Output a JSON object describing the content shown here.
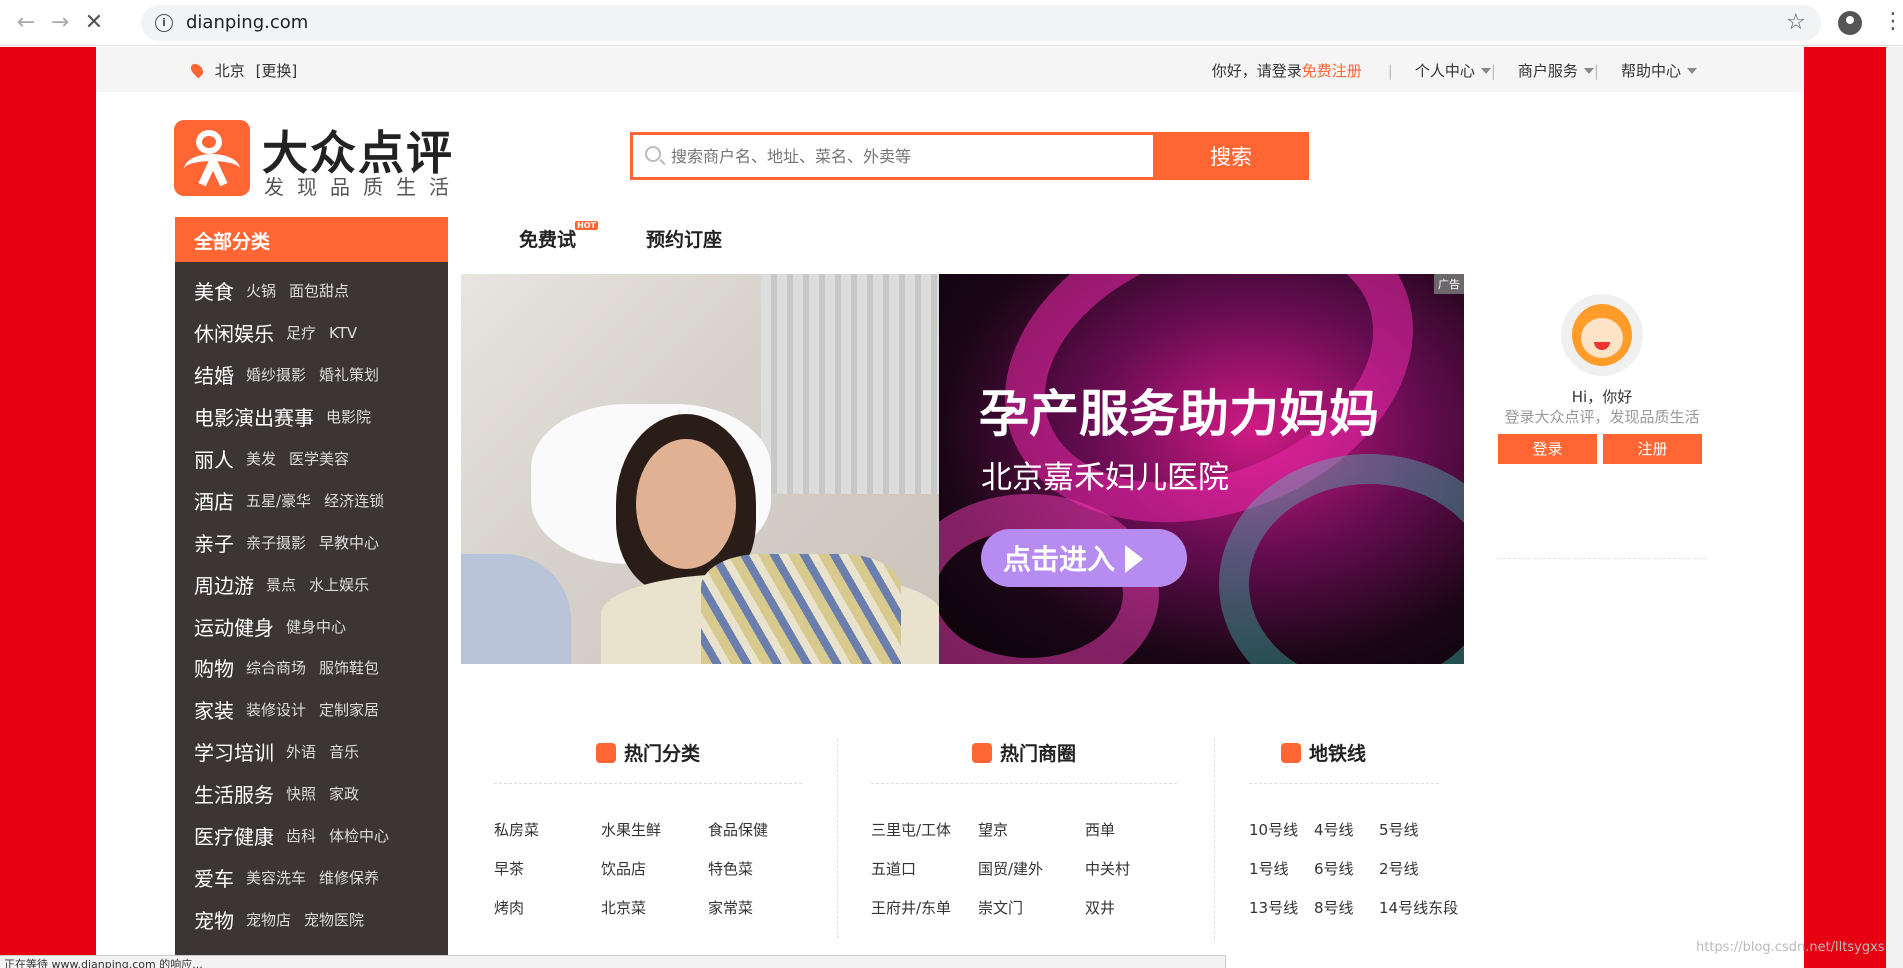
{
  "browser": {
    "url": "dianping.com",
    "back_icon": "back-arrow-icon",
    "forward_icon": "forward-arrow-icon",
    "reload_icon": "stop-loading-icon"
  },
  "topbar": {
    "city": "北京",
    "change": "[更换]",
    "greeting": "你好，请登录",
    "register": "免费注册",
    "menus": [
      "个人中心",
      "商户服务",
      "帮助中心"
    ]
  },
  "logo": {
    "title": "大众点评",
    "subtitle": "发现品质生活"
  },
  "search": {
    "placeholder": "搜索商户名、地址、菜名、外卖等",
    "button": "搜索"
  },
  "categories": {
    "header": "全部分类",
    "items": [
      {
        "main": "美食",
        "subs": [
          "火锅",
          "面包甜点"
        ]
      },
      {
        "main": "休闲娱乐",
        "subs": [
          "足疗",
          "KTV"
        ]
      },
      {
        "main": "结婚",
        "subs": [
          "婚纱摄影",
          "婚礼策划"
        ]
      },
      {
        "main": "电影演出赛事",
        "subs": [
          "电影院"
        ]
      },
      {
        "main": "丽人",
        "subs": [
          "美发",
          "医学美容"
        ]
      },
      {
        "main": "酒店",
        "subs": [
          "五星/豪华",
          "经济连锁"
        ]
      },
      {
        "main": "亲子",
        "subs": [
          "亲子摄影",
          "早教中心"
        ]
      },
      {
        "main": "周边游",
        "subs": [
          "景点",
          "水上娱乐"
        ]
      },
      {
        "main": "运动健身",
        "subs": [
          "健身中心"
        ]
      },
      {
        "main": "购物",
        "subs": [
          "综合商场",
          "服饰鞋包"
        ]
      },
      {
        "main": "家装",
        "subs": [
          "装修设计",
          "定制家居"
        ]
      },
      {
        "main": "学习培训",
        "subs": [
          "外语",
          "音乐"
        ]
      },
      {
        "main": "生活服务",
        "subs": [
          "快照",
          "家政"
        ]
      },
      {
        "main": "医疗健康",
        "subs": [
          "齿科",
          "体检中心"
        ]
      },
      {
        "main": "爱车",
        "subs": [
          "美容洗车",
          "维修保养"
        ]
      },
      {
        "main": "宠物",
        "subs": [
          "宠物店",
          "宠物医院"
        ]
      }
    ]
  },
  "midnav": {
    "trial": "免费试",
    "hot": "HOT",
    "reserve": "预约订座"
  },
  "banner": {
    "ad_tag": "广告",
    "headline": "孕产服务助力妈妈",
    "hospital": "北京嘉禾妇儿医院",
    "cta": "点击进入"
  },
  "user": {
    "hi": "Hi，你好",
    "desc": "登录大众点评，发现品质生活",
    "login": "登录",
    "register": "注册"
  },
  "hot_categories": {
    "title": "热门分类",
    "links": [
      "私房菜",
      "水果生鲜",
      "食品保健",
      "早茶",
      "饮品店",
      "特色菜",
      "烤肉",
      "北京菜",
      "家常菜"
    ]
  },
  "hot_areas": {
    "title": "热门商圈",
    "links": [
      "三里屯/工体",
      "望京",
      "西单",
      "五道口",
      "国贸/建外",
      "中关村",
      "王府井/东单",
      "崇文门",
      "双井"
    ]
  },
  "subway": {
    "title": "地铁线",
    "links": [
      "10号线",
      "4号线",
      "5号线",
      "1号线",
      "6号线",
      "2号线",
      "13号线",
      "8号线",
      "14号线东段"
    ]
  },
  "watermark": "https://blog.csdn.net/lltsygxs",
  "status": "正在等待 www.dianping.com 的响应..."
}
